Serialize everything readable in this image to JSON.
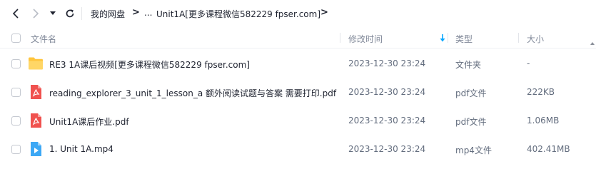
{
  "nav": {
    "back_icon": "chevron-left-icon",
    "forward_icon": "chevron-right-icon",
    "dropdown_icon": "caret-down-icon",
    "refresh_icon": "refresh-icon"
  },
  "breadcrumb": {
    "root": "我的网盘",
    "sep1": ">",
    "ellipsis": "...",
    "current": "Unit1A[更多课程微信582229 fpser.com]",
    "sep2": ">"
  },
  "table": {
    "headers": {
      "name": "文件名",
      "modified": "修改时间",
      "type": "类型",
      "size": "大小"
    },
    "sort_icon": "sort-down-arrow-icon",
    "rows": [
      {
        "icon": "folder-icon",
        "name": "RE3 1A课后视频[更多课程微信582229 fpser.com]",
        "modified": "2023-12-30 23:24",
        "type": "文件夹",
        "size": "-"
      },
      {
        "icon": "pdf-icon",
        "name": "reading_explorer_3_unit_1_lesson_a 额外阅读试题与答案 需要打印.pdf",
        "modified": "2023-12-30 23:24",
        "type": "pdf文件",
        "size": "222KB"
      },
      {
        "icon": "pdf-icon",
        "name": "Unit1A课后作业.pdf",
        "modified": "2023-12-30 23:24",
        "type": "pdf文件",
        "size": "1.06MB"
      },
      {
        "icon": "video-icon",
        "name": "1. Unit 1A.mp4",
        "modified": "2023-12-30 23:24",
        "type": "mp4文件",
        "size": "402.41MB"
      }
    ]
  },
  "colors": {
    "accent": "#06a7ff",
    "folder": "#ffc53d",
    "pdf": "#f0524f",
    "video": "#3da8f5"
  }
}
